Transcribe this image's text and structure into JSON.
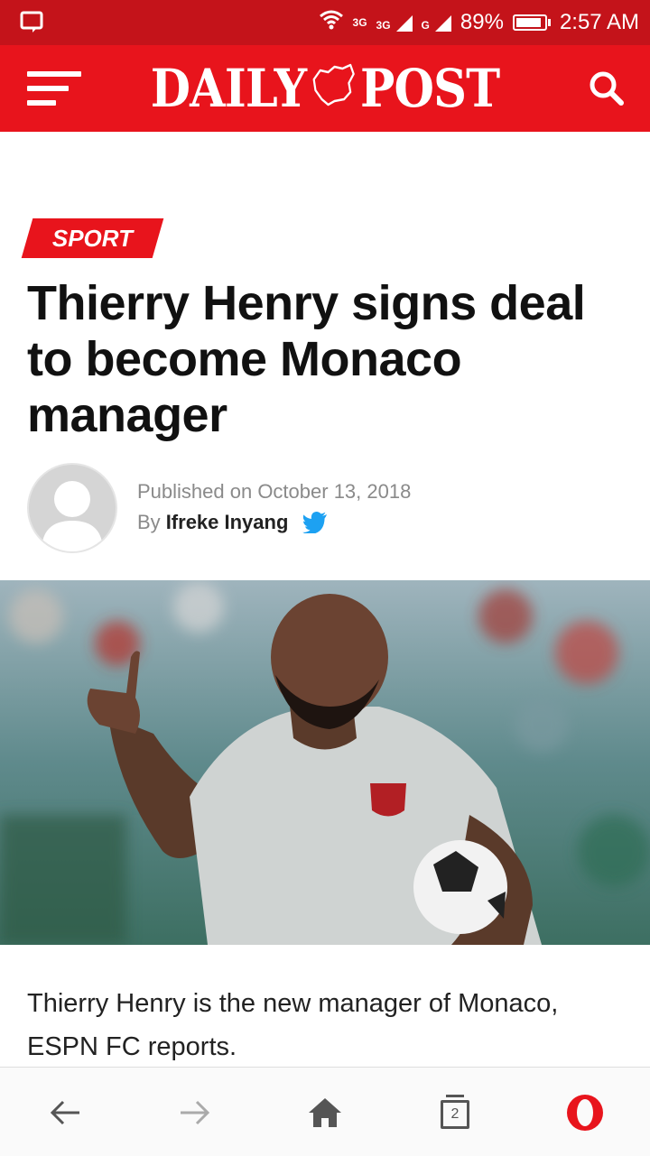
{
  "status_bar": {
    "network_1": "3G",
    "network_2": "3G",
    "network_3": "G",
    "battery": "89%",
    "battery_level": 0.89,
    "time": "2:57 AM"
  },
  "header": {
    "logo_left": "DAILY",
    "logo_right": "POST",
    "brand_color": "#e8141c"
  },
  "article": {
    "category": "SPORT",
    "title": "Thierry Henry signs deal to become Monaco manager",
    "published": "Published on October 13, 2018",
    "by_label": "By",
    "author": "Ifreke Inyang",
    "body": "Thierry Henry is the new manager of Monaco, ESPN FC reports."
  },
  "browser": {
    "tab_count": "2"
  },
  "icons": [
    "notification-icon",
    "wifi-icon",
    "signal-icon",
    "battery-icon",
    "menu-icon",
    "nigeria-map-icon",
    "search-icon",
    "avatar-icon",
    "twitter-icon",
    "back-arrow-icon",
    "forward-arrow-icon",
    "home-icon",
    "tabs-icon",
    "opera-icon"
  ]
}
